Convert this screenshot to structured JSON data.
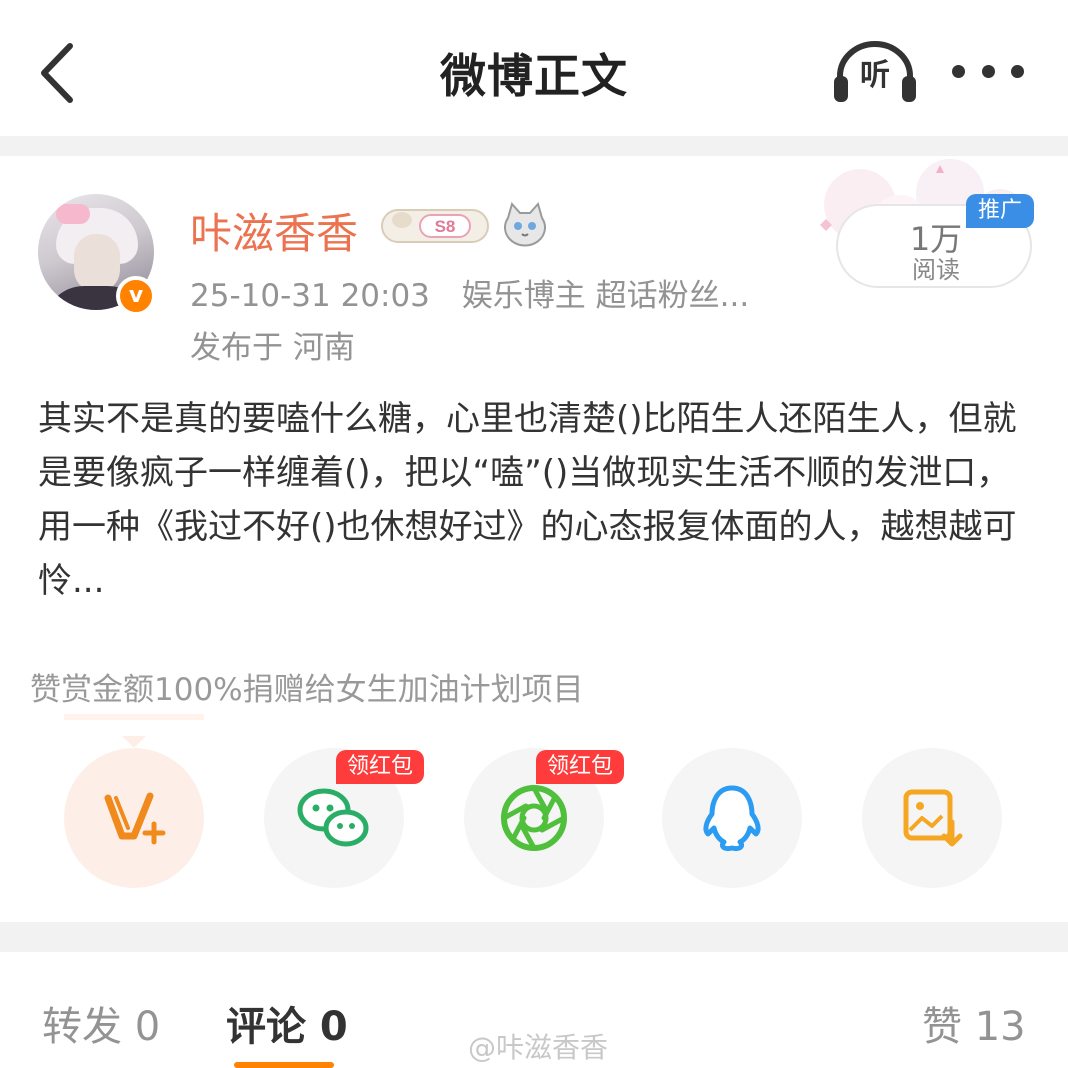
{
  "header": {
    "title": "微博正文",
    "listen_label": "听",
    "icons": {
      "back": "chevron-left-icon",
      "listen": "headphones-icon",
      "more": "more-dots-icon"
    }
  },
  "post": {
    "username": "咔滋香香",
    "level_badge": "S8",
    "timestamp": "25-10-31 20:03",
    "tags": "娱乐博主 超话粉丝...",
    "location": "发布于 河南",
    "read_count": "1万",
    "read_label": "阅读",
    "ad_label": "推广",
    "verified_badge": "v",
    "content": "其实不是真的要嗑什么糖，心里也清楚()比陌生人还陌生人，但就是要像疯子一样缠着()，把以“嗑”()当做现实生活不顺的发泄口，用一种《我过不好()也休想好过》的心态报复体面的人，越想越可怜..."
  },
  "reward": {
    "text": "赞赏金额100%捐赠给女生加油计划项目"
  },
  "share": {
    "items": [
      {
        "name": "vplus",
        "icon": "vplus-icon"
      },
      {
        "name": "wechat",
        "icon": "wechat-icon",
        "tag": "领红包"
      },
      {
        "name": "moments",
        "icon": "moments-icon",
        "tag": "领红包"
      },
      {
        "name": "qq",
        "icon": "qq-icon"
      },
      {
        "name": "save-image",
        "icon": "save-image-icon"
      }
    ]
  },
  "tabs": {
    "repost": "转发 0",
    "comment": "评论 0",
    "like": "赞 13"
  },
  "watermark": "@咔滋香香",
  "colors": {
    "accent": "#ff8200",
    "username": "#eb7350",
    "ad_blue": "#3a8ee6",
    "red_tag": "#ff3c3c",
    "wechat_green": "#2aae67",
    "moments_green": "#4fbf3c",
    "qq_blue": "#2b9cf2",
    "save_orange": "#f5a623"
  }
}
